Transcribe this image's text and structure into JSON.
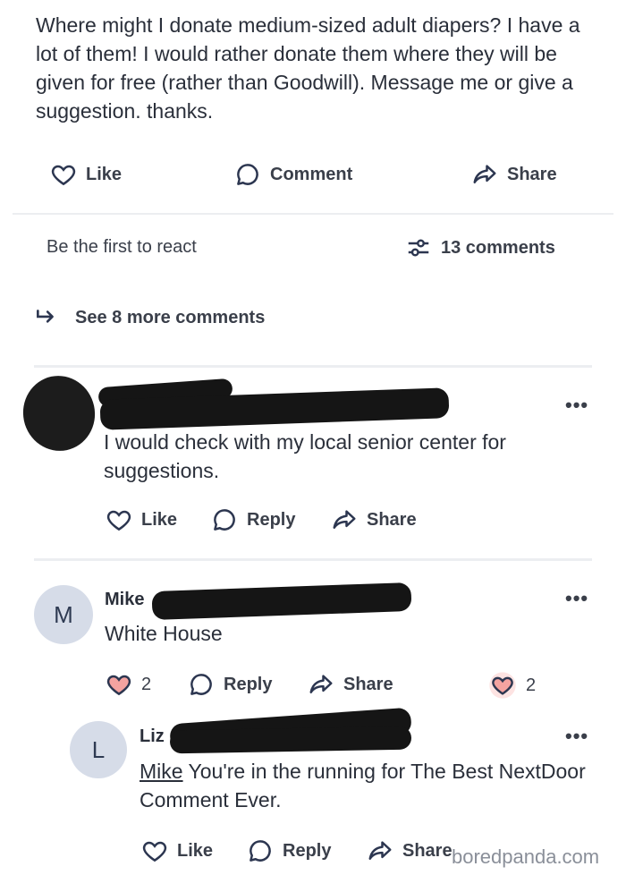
{
  "post": {
    "text": "Where might I donate medium-sized adult diapers?  I have a lot of them! I would rather donate them where they will be given for free (rather than Goodwill).  Message me or give a suggestion.  thanks.",
    "actions": {
      "like": "Like",
      "comment": "Comment",
      "share": "Share"
    },
    "react_text": "Be the first to react",
    "comments_count": "13 comments",
    "see_more": "See 8 more comments"
  },
  "comments": [
    {
      "name": "",
      "text": "I would check with my local senior center for suggestions.",
      "actions": {
        "like": "Like",
        "reply": "Reply",
        "share": "Share"
      }
    },
    {
      "avatar_letter": "M",
      "name": "Mike",
      "text": "White House",
      "like_count": "2",
      "reaction_count": "2",
      "actions": {
        "reply": "Reply",
        "share": "Share"
      },
      "reply": {
        "avatar_letter": "L",
        "name": "Liz",
        "mention": "Mike",
        "text": " You're in the running for The Best NextDoor Comment Ever.",
        "actions": {
          "like": "Like",
          "reply": "Reply",
          "share": "Share"
        }
      }
    }
  ],
  "more_icon_text": "•••",
  "watermark": "boredpanda.com",
  "colors": {
    "heart_fill": "#f4a3a0",
    "heart_stroke": "#2c3650",
    "text": "#2a2f3a"
  }
}
